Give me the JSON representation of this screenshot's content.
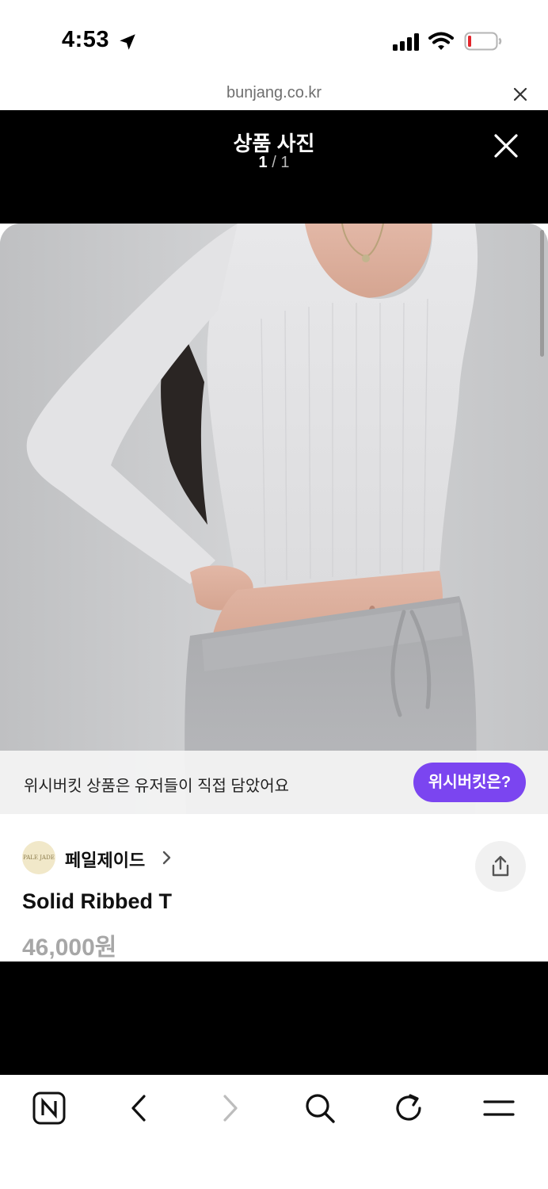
{
  "status_bar": {
    "time": "4:53",
    "icons": [
      "location-arrow-icon",
      "cellular-signal-icon",
      "wifi-icon",
      "battery-low-icon"
    ],
    "battery_color": "#e3262c"
  },
  "browser": {
    "url": "bunjang.co.kr"
  },
  "viewer": {
    "title": "상품 사진",
    "counter_current": "1",
    "counter_separator": "/",
    "counter_total": "1",
    "background": "#000000"
  },
  "wish_banner": {
    "text": "위시버킷 상품은 유저들이 직접 담았어요",
    "button_label": "위시버킷은?",
    "button_color": "#7b45f0"
  },
  "product": {
    "shop_name": "페일제이드",
    "shop_logo_text": "PALE JADE",
    "name": "Solid Ribbed T",
    "price": "46,000원"
  },
  "toolbar": {
    "icons": [
      "naver-n-icon",
      "back-icon",
      "forward-icon",
      "search-icon",
      "reload-icon",
      "menu-icon"
    ]
  }
}
